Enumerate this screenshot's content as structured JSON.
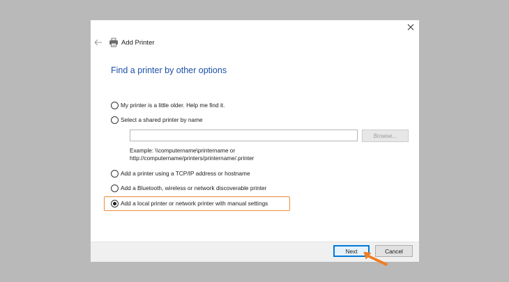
{
  "window": {
    "title": "Add Printer"
  },
  "page": {
    "heading": "Find a printer by other options"
  },
  "options": [
    {
      "label": "My printer is a little older. Help me find it.",
      "selected": false
    },
    {
      "label": "Select a shared printer by name",
      "selected": false
    },
    {
      "label": "Add a printer using a TCP/IP address or hostname",
      "selected": false
    },
    {
      "label": "Add a Bluetooth, wireless or network discoverable printer",
      "selected": false
    },
    {
      "label": "Add a local printer or network printer with manual settings",
      "selected": true
    }
  ],
  "shared_printer": {
    "value": "",
    "browse_label": "Browse...",
    "example_line1": "Example: \\\\computername\\printername or",
    "example_line2": "http://computername/printers/printername/.printer"
  },
  "footer": {
    "next_label": "Next",
    "cancel_label": "Cancel"
  },
  "colors": {
    "backdrop": "#bab9ba",
    "heading": "#1c4fa8",
    "highlight": "#ec8b36",
    "default_button_border": "#0078d7"
  },
  "icons": {
    "close": "close-icon",
    "back": "back-arrow-icon",
    "printer": "printer-icon",
    "pointer": "pointer-arrow-icon"
  }
}
